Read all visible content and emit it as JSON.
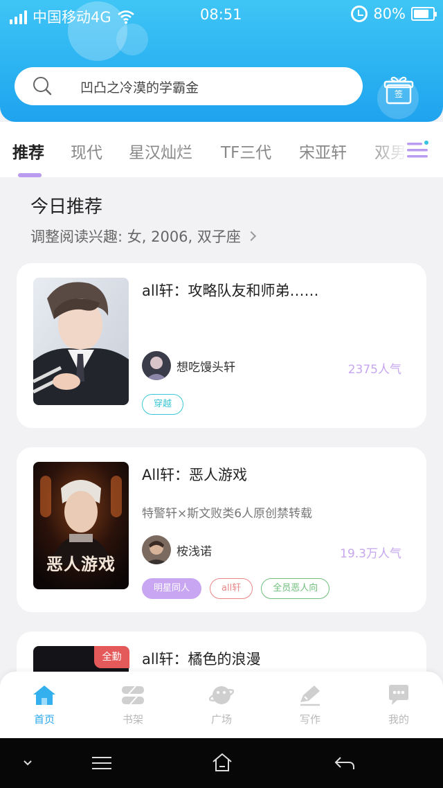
{
  "status_bar": {
    "carrier": "中国移动4G",
    "time": "08:51",
    "battery": "80%"
  },
  "search": {
    "placeholder": "凹凸之冷漠的学霸金",
    "sign_in_label": "签"
  },
  "tabs": [
    {
      "label": "推荐",
      "active": true
    },
    {
      "label": "现代"
    },
    {
      "label": "星汉灿烂"
    },
    {
      "label": "TF三代"
    },
    {
      "label": "宋亚轩"
    },
    {
      "label": "双男"
    }
  ],
  "recommend": {
    "title": "今日推荐",
    "subtitle": "调整阅读兴趣: 女, 2006, 双子座"
  },
  "books": [
    {
      "title": "all轩：攻略队友和师弟……",
      "description": "",
      "author": "想吃馒头轩",
      "popularity": "2375人气",
      "tags": [
        {
          "label": "穿越",
          "color": "#3cc7d8"
        }
      ]
    },
    {
      "title": "All轩：恶人游戏",
      "description": "特警轩×斯文败类6人原创禁转载",
      "author": "桉浅诺",
      "popularity": "19.3万人气",
      "cover_text": "恶人游戏",
      "tags": [
        {
          "label": "明星同人",
          "color": "#c9a6f2"
        },
        {
          "label": "all轩",
          "color": "#e88686"
        },
        {
          "label": "全员恶人向",
          "color": "#6dbf7a"
        }
      ]
    },
    {
      "title": "all轩：橘色的浪漫",
      "badge": "全勤"
    }
  ],
  "bottom_nav": [
    {
      "label": "首页",
      "active": true
    },
    {
      "label": "书架"
    },
    {
      "label": "广场"
    },
    {
      "label": "写作"
    },
    {
      "label": "我的"
    }
  ],
  "colors": {
    "header": "#2ab1f1",
    "accent_purple": "#b99cf0",
    "nav_active": "#2aa8ef",
    "popularity": "#c6a7ef"
  }
}
